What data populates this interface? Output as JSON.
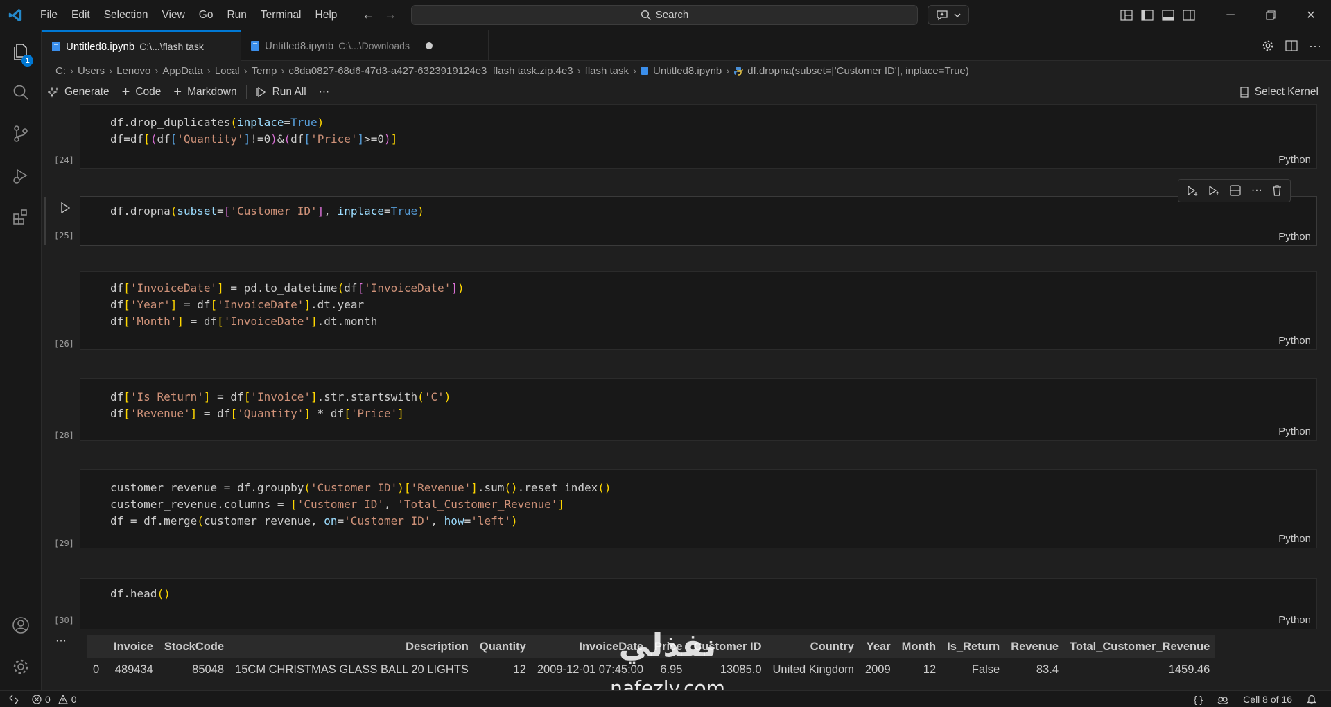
{
  "menu": [
    "File",
    "Edit",
    "Selection",
    "View",
    "Go",
    "Run",
    "Terminal",
    "Help"
  ],
  "search": {
    "label": "Search"
  },
  "activity": {
    "explorer_badge": "1"
  },
  "tabs": [
    {
      "title": "Untitled8.ipynb",
      "path": "C:\\...\\flash task",
      "active": true
    },
    {
      "title": "Untitled8.ipynb",
      "path": "C:\\...\\Downloads",
      "active": false,
      "dirty": true
    }
  ],
  "breadcrumb": [
    "C:",
    "Users",
    "Lenovo",
    "AppData",
    "Local",
    "Temp",
    "c8da0827-68d6-47d3-a427-6323919124e3_flash task.zip.4e3",
    "flash task",
    "Untitled8.ipynb",
    "df.dropna(subset=['Customer ID'], inplace=True)"
  ],
  "toolbar": {
    "generate": "Generate",
    "code": "Code",
    "markdown": "Markdown",
    "run_all": "Run All",
    "more": "···",
    "select_kernel": "Select Kernel"
  },
  "cells": [
    {
      "count": "[24]",
      "language": "Python"
    },
    {
      "count": "[25]",
      "language": "Python"
    },
    {
      "count": "[26]",
      "language": "Python"
    },
    {
      "count": "[28]",
      "language": "Python"
    },
    {
      "count": "[29]",
      "language": "Python"
    },
    {
      "count": "[30]",
      "language": "Python"
    }
  ],
  "output": {
    "more": "···",
    "columns": [
      "",
      "Invoice",
      "StockCode",
      "Description",
      "Quantity",
      "InvoiceDate",
      "Price",
      "Customer ID",
      "Country",
      "Year",
      "Month",
      "Is_Return",
      "Revenue",
      "Total_Customer_Revenue"
    ],
    "rows": [
      [
        "0",
        "489434",
        "85048",
        "15CM CHRISTMAS GLASS BALL 20 LIGHTS",
        "12",
        "2009-12-01 07:45:00",
        "6.95",
        "13085.0",
        "United Kingdom",
        "2009",
        "12",
        "False",
        "83.4",
        "1459.46"
      ]
    ]
  },
  "watermark": {
    "arabic": "نفذلي",
    "site": "nafezly.com"
  },
  "status": {
    "errors": "0",
    "warnings": "0",
    "braces": "{ }",
    "cell_position": "Cell 8 of 16"
  },
  "colors": {
    "accent": "#0078d4",
    "background": "#1f1f1f",
    "string": "#ce9178",
    "keyword_arg": "#9cdcfe",
    "constant": "#569cd6"
  }
}
